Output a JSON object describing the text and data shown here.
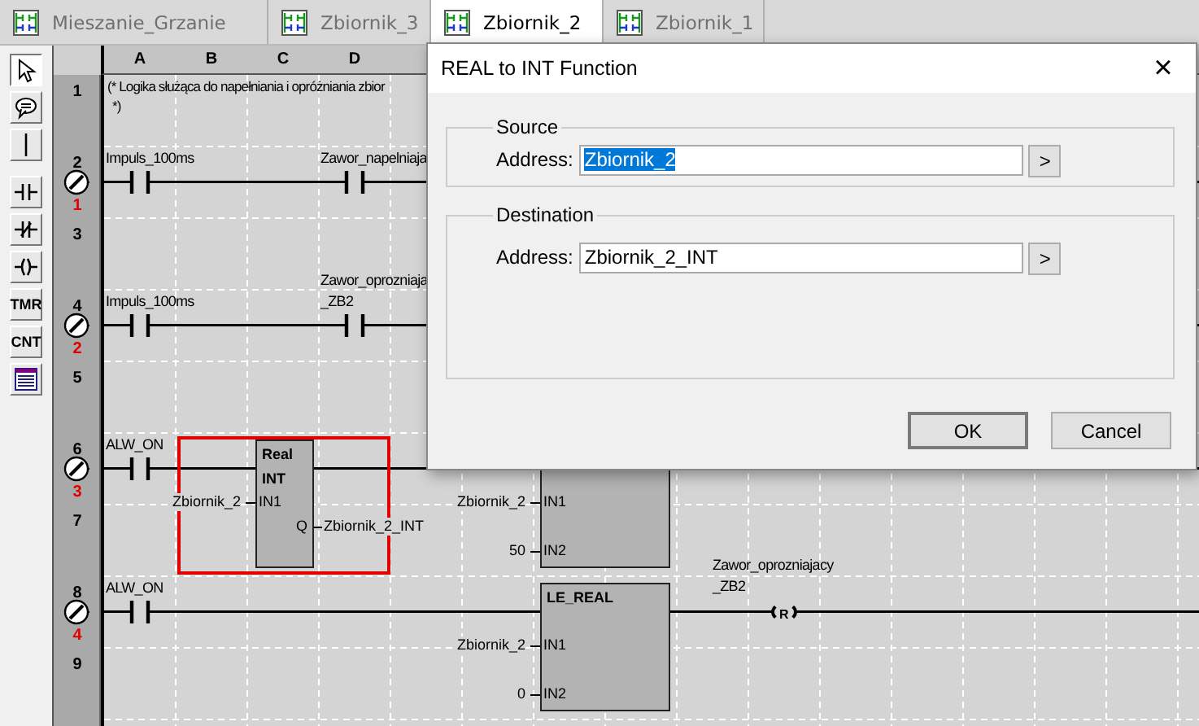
{
  "tabs": [
    {
      "label": "Mieszanie_Grzanie",
      "selected": false
    },
    {
      "label": "Zbiornik_3",
      "selected": false
    },
    {
      "label": "Zbiornik_2",
      "selected": true
    },
    {
      "label": "Zbiornik_1",
      "selected": false
    }
  ],
  "toolbar": [
    {
      "kind": "pointer",
      "selected": true
    },
    {
      "kind": "comment",
      "selected": false
    },
    {
      "kind": "line",
      "selected": false
    },
    {
      "kind": "contact",
      "selected": false
    },
    {
      "kind": "contact_nc",
      "selected": false
    },
    {
      "kind": "coil",
      "selected": false
    },
    {
      "kind": "text",
      "label": "TMR",
      "selected": false
    },
    {
      "kind": "text",
      "label": "CNT",
      "selected": false
    },
    {
      "kind": "list",
      "selected": false
    }
  ],
  "columns": [
    "A",
    "B",
    "C",
    "D"
  ],
  "line_numbers": [
    "1",
    "2",
    "3",
    "4",
    "5",
    "6",
    "7",
    "8",
    "9"
  ],
  "comment": [
    "(* Logika służąca do napełniania i opróżniania zbior",
    "*)"
  ],
  "rungs": [
    {
      "number": "1",
      "contacts": [
        {
          "label": [
            "Impuls_100ms"
          ]
        },
        {
          "label": [
            "Zawor_napelniaja"
          ]
        }
      ]
    },
    {
      "number": "2",
      "contacts": [
        {
          "label": [
            "Impuls_100ms"
          ]
        },
        {
          "label": [
            "Zawor_oprozniaja",
            "_ZB2"
          ]
        }
      ]
    },
    {
      "number": "3",
      "contacts": [
        {
          "label": [
            "ALW_ON"
          ]
        }
      ],
      "blocks": [
        {
          "title": [
            "Real",
            "INT"
          ],
          "inputs": [
            {
              "pin": "IN1",
              "operand": "Zbiornik_2"
            }
          ],
          "outputs": [
            {
              "pin": "Q",
              "operand": "Zbiornik_2_INT"
            }
          ],
          "selected": true
        },
        {
          "inputs": [
            {
              "pin": "IN1",
              "operand": "Zbiornik_2"
            },
            {
              "pin": "IN2",
              "operand": "50"
            }
          ],
          "selected": false
        }
      ]
    },
    {
      "number": "4",
      "contacts": [
        {
          "label": [
            "ALW_ON"
          ]
        }
      ],
      "blocks": [
        {
          "title": [
            "LE_REAL"
          ],
          "inputs": [
            {
              "pin": "IN1",
              "operand": "Zbiornik_2"
            },
            {
              "pin": "IN2",
              "operand": "0"
            }
          ],
          "selected": false
        }
      ],
      "coils": [
        {
          "label": [
            "Zawor_oprozniajacy",
            "_ZB2"
          ],
          "type": "R"
        }
      ]
    }
  ],
  "dialog": {
    "title": "REAL to INT Function",
    "close": "×",
    "groups": [
      {
        "title": "Source",
        "label": "Address:",
        "value": "Zbiornik_2",
        "selected": true,
        "browse": ">"
      },
      {
        "title": "Destination",
        "label": "Address:",
        "value": "Zbiornik_2_INT",
        "selected": false,
        "browse": ">"
      }
    ],
    "buttons": [
      "OK",
      "Cancel"
    ]
  }
}
